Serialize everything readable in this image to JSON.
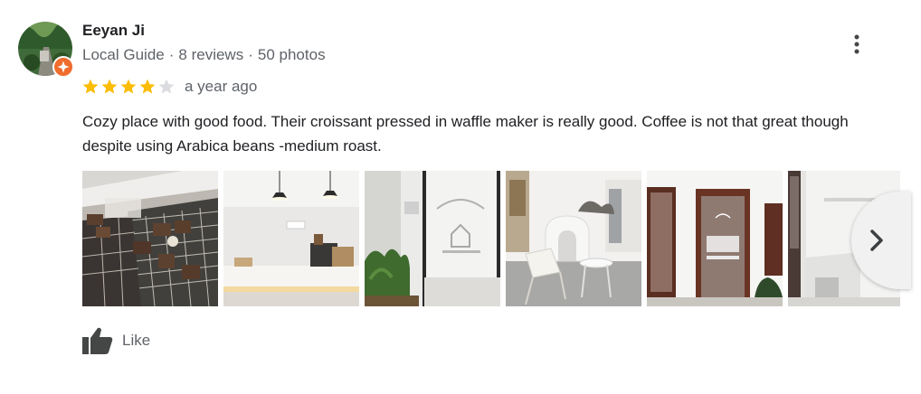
{
  "reviewer": {
    "name": "Eeyan Ji",
    "badge": "Local Guide",
    "reviews": "8 reviews",
    "photos": "50 photos",
    "separator": "·"
  },
  "review": {
    "rating": 4,
    "max_rating": 5,
    "time": "a year ago",
    "text": "Cozy place with good food. Their croissant pressed in waffle maker is really good. Coffee is not that great though despite using Arabica beans -medium roast."
  },
  "photos": [
    {
      "subject": "pastries on cooling racks in display case"
    },
    {
      "subject": "counter with pendant lamps"
    },
    {
      "subject": "glass door with hello & welcome sign"
    },
    {
      "subject": "white table and chairs"
    },
    {
      "subject": "wooden entrance doors"
    },
    {
      "subject": "white wall corner with plant"
    }
  ],
  "actions": {
    "like_label": "Like"
  },
  "icons": {
    "more": "more-vert-icon",
    "next": "chevron-right-icon",
    "like": "thumb-up-icon",
    "badge": "local-guide-badge-icon"
  },
  "colors": {
    "star_filled": "#fbbc04",
    "star_empty": "#dadce0",
    "badge": "#f06c2c",
    "secondary_text": "#5f6368"
  }
}
